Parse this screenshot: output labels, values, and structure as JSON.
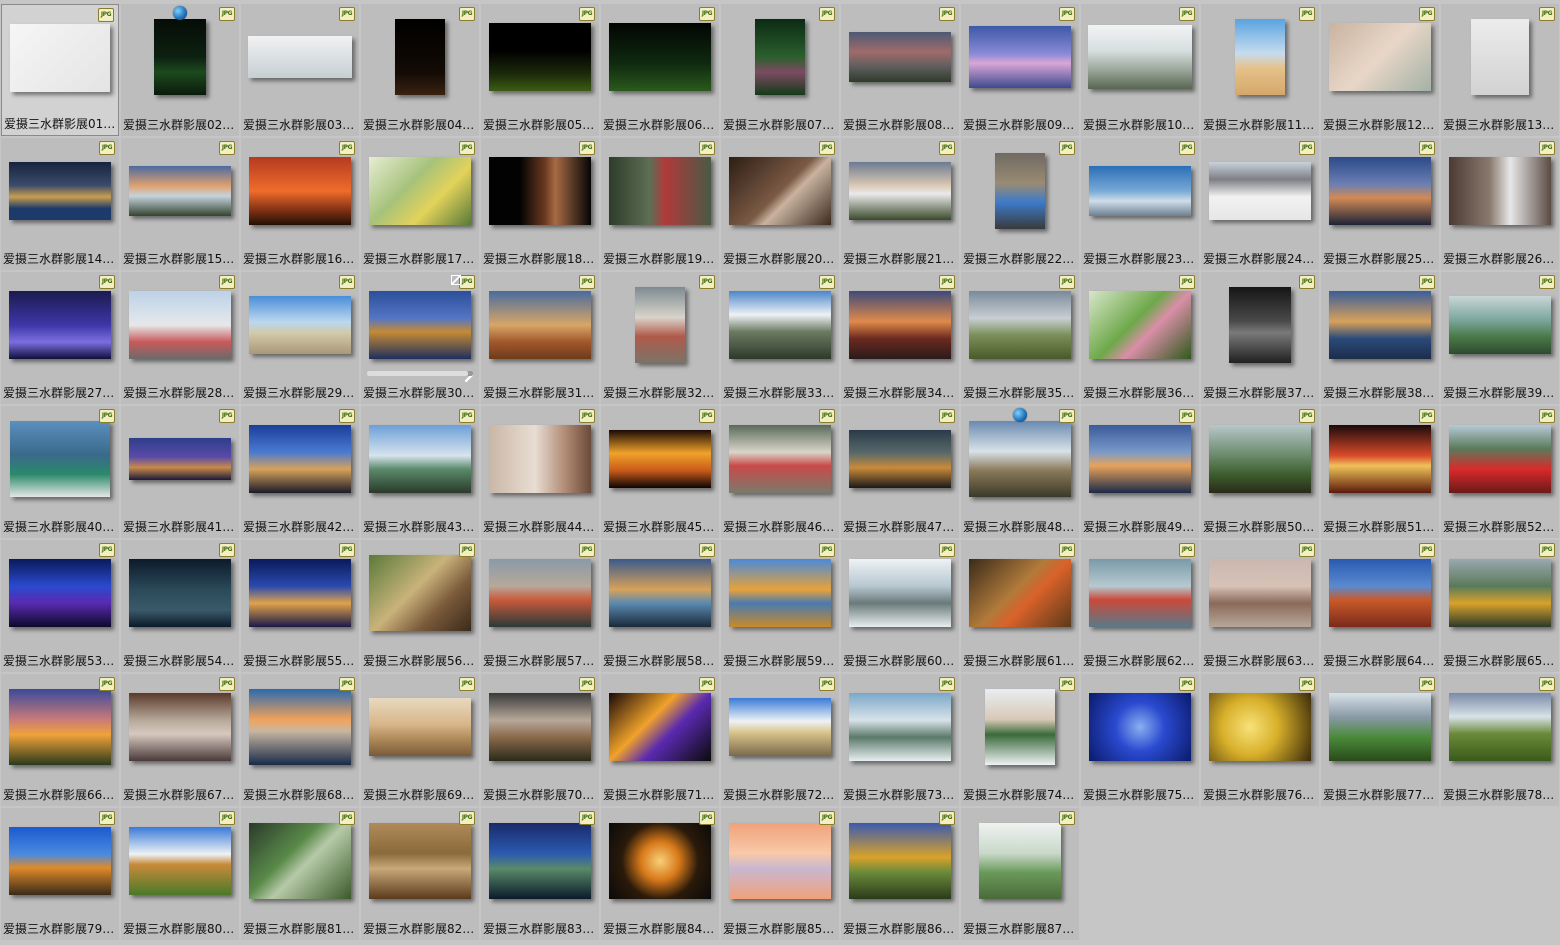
{
  "file_type_badge": "JPG",
  "files": [
    {
      "name": "爱摄三水群影展01.j...",
      "thumb": {
        "w": 100,
        "h": 68,
        "bg": "linear-gradient(135deg,#f6f6f6,#e4e4e4)"
      }
    },
    {
      "name": "爱摄三水群影展02.j...",
      "thumb": {
        "w": 52,
        "h": 76,
        "bg": "linear-gradient(180deg,#050c07 0%,#0d2010 50%,#1d4a1e 70%,#0a1a0c 100%)"
      }
    },
    {
      "name": "爱摄三水群影展03.j...",
      "thumb": {
        "w": 104,
        "h": 42,
        "bg": "linear-gradient(180deg,#f2f2f2,#d7dde0 60%,#c8cfd3)"
      }
    },
    {
      "name": "爱摄三水群影展04.J...",
      "thumb": {
        "w": 50,
        "h": 76,
        "bg": "linear-gradient(180deg,#000,#120a05 70%,#3a2210)"
      }
    },
    {
      "name": "爱摄三水群影展05.J...",
      "thumb": {
        "w": 102,
        "h": 68,
        "bg": "linear-gradient(180deg,#000 40%,#1c2a0a 75%,#3c5d12)"
      }
    },
    {
      "name": "爱摄三水群影展06.J...",
      "thumb": {
        "w": 102,
        "h": 68,
        "bg": "linear-gradient(180deg,#020502,#0f2a10 60%,#2b5a1c)"
      }
    },
    {
      "name": "爱摄三水群影展07.j...",
      "thumb": {
        "w": 50,
        "h": 76,
        "bg": "linear-gradient(180deg,#0c2a14,#2b5f2d 50%,#7c4b62 70%,#153a19)"
      }
    },
    {
      "name": "爱摄三水群影展08.j...",
      "thumb": {
        "w": 102,
        "h": 50,
        "bg": "linear-gradient(180deg,#4d5a73,#a06b6b 40%,#5d5d5d 70%,#2f3b2a)"
      }
    },
    {
      "name": "爱摄三水群影展09.j...",
      "thumb": {
        "w": 102,
        "h": 62,
        "bg": "linear-gradient(180deg,#3d59a7,#8a8ad6 45%,#d9a6d6 60%,#3d4a8f)"
      }
    },
    {
      "name": "爱摄三水群影展10.j...",
      "thumb": {
        "w": 104,
        "h": 64,
        "bg": "linear-gradient(180deg,#f2f4f4,#d7dfe0 40%,#9aa79a 70%,#586652)"
      }
    },
    {
      "name": "爱摄三水群影展11.j...",
      "thumb": {
        "w": 50,
        "h": 76,
        "bg": "linear-gradient(180deg,#5aa3e0,#c6dcef 45%,#e6c189 65%,#d4a86b)"
      }
    },
    {
      "name": "爱摄三水群影展12.j...",
      "thumb": {
        "w": 102,
        "h": 68,
        "bg": "linear-gradient(135deg,#c9b3a0,#e8d7c8 50%,#a4b1a6)"
      }
    },
    {
      "name": "爱摄三水群影展13.J...",
      "thumb": {
        "w": 58,
        "h": 76,
        "bg": "linear-gradient(180deg,#ececec,#d2d2d2)"
      }
    },
    {
      "name": "爱摄三水群影展14.j...",
      "thumb": {
        "w": 102,
        "h": 58,
        "bg": "linear-gradient(180deg,#17243d,#3a4a6b 40%,#c89e4f 60%,#1c3b6b 80%)"
      }
    },
    {
      "name": "爱摄三水群影展15.j...",
      "thumb": {
        "w": 102,
        "h": 50,
        "bg": "linear-gradient(180deg,#4d6a9f,#e0a26f 40%,#c5d3dc 60%,#33432f)"
      }
    },
    {
      "name": "爱摄三水群影展16.j...",
      "thumb": {
        "w": 102,
        "h": 68,
        "bg": "linear-gradient(180deg,#b53a1f,#f06c2b 50%,#7a2d14 80%,#221005)"
      }
    },
    {
      "name": "爱摄三水群影展17.j...",
      "thumb": {
        "w": 102,
        "h": 68,
        "bg": "linear-gradient(135deg,#e6edd4,#a6c27a 40%,#e3d35a 65%,#587a38)"
      }
    },
    {
      "name": "爱摄三水群影展18.j...",
      "thumb": {
        "w": 102,
        "h": 68,
        "bg": "linear-gradient(90deg,#020202 30%,#6b3a22 55%,#a76a44 65%,#050505)"
      }
    },
    {
      "name": "爱摄三水群影展19.j...",
      "thumb": {
        "w": 102,
        "h": 68,
        "bg": "linear-gradient(90deg,#2e3c2a,#5d6f55 40%,#b03a3a 55%,#4a5a45)"
      }
    },
    {
      "name": "爱摄三水群影展20.J...",
      "thumb": {
        "w": 102,
        "h": 68,
        "bg": "linear-gradient(135deg,#2d1d14,#7a5a44 50%,#c9b3a0 60%,#3b2a1f)"
      }
    },
    {
      "name": "爱摄三水群影展21.j...",
      "thumb": {
        "w": 102,
        "h": 58,
        "bg": "linear-gradient(180deg,#6c7b92,#d9c8b3 40%,#eaeaea 55%,#3a4a2a)"
      }
    },
    {
      "name": "爱摄三水群影展22.j...",
      "thumb": {
        "w": 50,
        "h": 76,
        "bg": "linear-gradient(180deg,#6f6a62,#9a8b74 40%,#3d7ac9 65%,#3a3a3a)"
      }
    },
    {
      "name": "爱摄三水群影展23.j...",
      "thumb": {
        "w": 102,
        "h": 50,
        "bg": "linear-gradient(180deg,#2a6fb6,#79a9d6 50%,#cfdde8 70%,#6d7f92)"
      }
    },
    {
      "name": "爱摄三水群影展24.j...",
      "thumb": {
        "w": 102,
        "h": 58,
        "bg": "linear-gradient(180deg,#c9d2da,#7e7f86 30%,#f2f2f2 60%,#e6e6e6)"
      }
    },
    {
      "name": "爱摄三水群影展25.j...",
      "thumb": {
        "w": 102,
        "h": 68,
        "bg": "linear-gradient(180deg,#2c4a8a,#6b7fb2 40%,#d28a55 60%,#1d2338)"
      }
    },
    {
      "name": "爱摄三水群影展26.j...",
      "thumb": {
        "w": 102,
        "h": 68,
        "bg": "linear-gradient(90deg,#4a3b34,#8a7a6e 40%,#e7e7e7 60%,#5b4b44)"
      }
    },
    {
      "name": "爱摄三水群影展27.J...",
      "thumb": {
        "w": 102,
        "h": 68,
        "bg": "linear-gradient(180deg,#1b1b4e,#3d36a8 50%,#7c6ee0 75%,#10103a)"
      }
    },
    {
      "name": "爱摄三水群影展28.j...",
      "thumb": {
        "w": 102,
        "h": 68,
        "bg": "linear-gradient(180deg,#bcd2e8,#e6e8ea 50%,#c95a5a 75%,#6a6a6a)"
      }
    },
    {
      "name": "爱摄三水群影展29.j...",
      "thumb": {
        "w": 102,
        "h": 58,
        "bg": "linear-gradient(180deg,#4a8ed8,#bcd8ef 45%,#d2c8a8 65%,#a89876)"
      }
    },
    {
      "name": "爱摄三水群影展30.j...",
      "thumb": {
        "w": 102,
        "h": 68,
        "bg": "linear-gradient(180deg,#2c4f9a,#5375c4 40%,#c58a34 60%,#1f2f5d)"
      },
      "hover": true
    },
    {
      "name": "爱摄三水群影展31.j...",
      "thumb": {
        "w": 102,
        "h": 68,
        "bg": "linear-gradient(180deg,#496b9e,#d8a667 50%,#a0582c 75%,#6d3b1b)"
      }
    },
    {
      "name": "爱摄三水群影展32.j...",
      "thumb": {
        "w": 50,
        "h": 76,
        "bg": "linear-gradient(180deg,#7e8a91,#d9d4cb 40%,#b05a4a 65%,#7b7368)"
      }
    },
    {
      "name": "爱摄三水群影展33.j...",
      "thumb": {
        "w": 102,
        "h": 68,
        "bg": "linear-gradient(180deg,#4c86c9,#eef2f5 35%,#6b7a62 60%,#2d3a2a)"
      }
    },
    {
      "name": "爱摄三水群影展34.j...",
      "thumb": {
        "w": 102,
        "h": 68,
        "bg": "linear-gradient(180deg,#3d4a7a,#e08a4a 45%,#6b2a1f 70%,#2a1a1a)"
      }
    },
    {
      "name": "爱摄三水群影展35.j...",
      "thumb": {
        "w": 102,
        "h": 68,
        "bg": "linear-gradient(180deg,#7a8a9a,#c9cfd3 40%,#7a8f5a 65%,#4a5a2a)"
      }
    },
    {
      "name": "爱摄三水群影展36.j...",
      "thumb": {
        "w": 102,
        "h": 68,
        "bg": "linear-gradient(135deg,#d7e6c9,#6ea84a 45%,#d98fa7 60%,#2f5a1e)"
      }
    },
    {
      "name": "爱摄三水群影展37.j...",
      "thumb": {
        "w": 62,
        "h": 76,
        "bg": "linear-gradient(180deg,#151515,#4a4a4a 45%,#7a7a7a 60%,#202020)"
      }
    },
    {
      "name": "爱摄三水群影展38.j...",
      "thumb": {
        "w": 102,
        "h": 68,
        "bg": "linear-gradient(180deg,#3a5e9a,#d8a15a 45%,#2a4a7a 70%,#1d2d4a)"
      }
    },
    {
      "name": "爱摄三水群影展39.j...",
      "thumb": {
        "w": 102,
        "h": 58,
        "bg": "linear-gradient(180deg,#c9d6d6,#7ea8a0 40%,#4a7a4a 70%,#2f4a2f)"
      }
    },
    {
      "name": "爱摄三水群影展40.j...",
      "thumb": {
        "w": 100,
        "h": 76,
        "bg": "linear-gradient(180deg,#5a8fbf,#3a6a8a 45%,#2a8a6a 70%,#e6e6e6)"
      }
    },
    {
      "name": "爱摄三水群影展41.j...",
      "thumb": {
        "w": 102,
        "h": 42,
        "bg": "linear-gradient(180deg,#2d3f8a,#5a4aa8 45%,#c98a4a 70%,#1a1a3a)"
      }
    },
    {
      "name": "爱摄三水群影展42.j...",
      "thumb": {
        "w": 102,
        "h": 68,
        "bg": "linear-gradient(180deg,#1a3e9a,#4a7ad0 40%,#d7a25a 65%,#1a1a2a)"
      }
    },
    {
      "name": "爱摄三水群影展43.j...",
      "thumb": {
        "w": 102,
        "h": 68,
        "bg": "linear-gradient(180deg,#6ca0d8,#d7e3ee 45%,#5a8a6a 65%,#2a3a2a)"
      }
    },
    {
      "name": "爱摄三水群影展44.j...",
      "thumb": {
        "w": 102,
        "h": 68,
        "bg": "linear-gradient(90deg,#c9b7a6,#e8ddd3 45%,#b08a74 75%,#6a4a3a)"
      }
    },
    {
      "name": "爱摄三水群影展45.j...",
      "thumb": {
        "w": 102,
        "h": 58,
        "bg": "linear-gradient(180deg,#1a0a05,#f0a22a 40%,#c95a1a 70%,#0a0505)"
      }
    },
    {
      "name": "爱摄三水群影展46.j...",
      "thumb": {
        "w": 102,
        "h": 68,
        "bg": "linear-gradient(180deg,#5a6a5a,#d9d5c9 40%,#c94a4a 60%,#7a7a6a)"
      }
    },
    {
      "name": "爱摄三水群影展47.j...",
      "thumb": {
        "w": 102,
        "h": 58,
        "bg": "linear-gradient(180deg,#2a3a4a,#5a6a6a 40%,#c98a3a 65%,#1a1a1a)"
      }
    },
    {
      "name": "爱摄三水群影展48.j...",
      "thumb": {
        "w": 102,
        "h": 76,
        "bg": "linear-gradient(180deg,#6a8ab0,#d8e2e8 40%,#8a7a5a 65%,#3a3a2a)"
      }
    },
    {
      "name": "爱摄三水群影展49.j...",
      "thumb": {
        "w": 102,
        "h": 68,
        "bg": "linear-gradient(180deg,#3a5a9a,#7a9ac9 40%,#e8a25a 60%,#1a2a4a)"
      }
    },
    {
      "name": "爱摄三水群影展50.j...",
      "thumb": {
        "w": 102,
        "h": 68,
        "bg": "linear-gradient(180deg,#b7c7c9,#6a8a6a 45%,#3a5a2a 75%,#2a2a1a)"
      }
    },
    {
      "name": "爱摄三水群影展51.j...",
      "thumb": {
        "w": 102,
        "h": 68,
        "bg": "linear-gradient(180deg,#1a0a0a,#d94a2a 45%,#f0c25a 60%,#5a1a0a)"
      }
    },
    {
      "name": "爱摄三水群影展52.j...",
      "thumb": {
        "w": 102,
        "h": 68,
        "bg": "linear-gradient(180deg,#b7c9d8,#5a7a5a 35%,#d92a2a 65%,#6a1a1a)"
      }
    },
    {
      "name": "爱摄三水群影展53.j...",
      "thumb": {
        "w": 102,
        "h": 68,
        "bg": "linear-gradient(180deg,#0a1a5a,#2a4ad0 40%,#5a2ab0 65%,#0a0a2a)"
      }
    },
    {
      "name": "爱摄三水群影展54.J...",
      "thumb": {
        "w": 102,
        "h": 68,
        "bg": "linear-gradient(180deg,#0d1a2a,#2a4a5a 45%,#3a5a6a 75%,#0a1a2a)"
      }
    },
    {
      "name": "爱摄三水群影展55.j...",
      "thumb": {
        "w": 102,
        "h": 68,
        "bg": "linear-gradient(180deg,#0a1a5a,#2a4ab0 40%,#e0a24a 65%,#1a1a4a)"
      }
    },
    {
      "name": "爱摄三水群影展56.j...",
      "thumb": {
        "w": 102,
        "h": 76,
        "bg": "linear-gradient(135deg,#5a7a3a,#c9b37a 45%,#7a5a3a 70%,#3a2a1a)"
      }
    },
    {
      "name": "爱摄三水群影展57.j...",
      "thumb": {
        "w": 102,
        "h": 68,
        "bg": "linear-gradient(180deg,#8a9aa8,#b7a89a 40%,#c95a3a 60%,#2a3a3a)"
      }
    },
    {
      "name": "爱摄三水群影展58.j...",
      "thumb": {
        "w": 102,
        "h": 68,
        "bg": "linear-gradient(180deg,#3a5a8a,#d8a25a 45%,#5a8ab0 65%,#1a2a3a)"
      }
    },
    {
      "name": "爱摄三水群影展59.j...",
      "thumb": {
        "w": 102,
        "h": 68,
        "bg": "linear-gradient(180deg,#4a8ad8,#e8a23a 45%,#4a7ab0 65%,#c98a2a)"
      }
    },
    {
      "name": "爱摄三水群影展60.j...",
      "thumb": {
        "w": 102,
        "h": 68,
        "bg": "linear-gradient(180deg,#eef2f5,#b7c7d0 40%,#6a7a7a 65%,#e8eef0)"
      }
    },
    {
      "name": "爱摄三水群影展61.j...",
      "thumb": {
        "w": 102,
        "h": 68,
        "bg": "linear-gradient(135deg,#3a2a1a,#b07a3a 45%,#d9622a 60%,#5a3a1a)"
      }
    },
    {
      "name": "爱摄三水群影展62.j...",
      "thumb": {
        "w": 102,
        "h": 68,
        "bg": "linear-gradient(180deg,#7a9aa8,#b7c9d0 40%,#c94a3a 60%,#5a7a8a)"
      }
    },
    {
      "name": "爱摄三水群影展63.j...",
      "thumb": {
        "w": 102,
        "h": 68,
        "bg": "linear-gradient(180deg,#c9b7b0,#d8c2b7 40%,#8a6a5a 65%,#b7a89a)"
      }
    },
    {
      "name": "爱摄三水群影展64.J...",
      "thumb": {
        "w": 102,
        "h": 68,
        "bg": "linear-gradient(180deg,#2a5ab0,#5a8ad0 40%,#c95a2a 60%,#7a2a1a)"
      }
    },
    {
      "name": "爱摄三水群影展65.j...",
      "thumb": {
        "w": 102,
        "h": 68,
        "bg": "linear-gradient(180deg,#9aa8b0,#5a7a5a 40%,#d8a22a 65%,#2a3a2a)"
      }
    },
    {
      "name": "爱摄三水群影展66.j...",
      "thumb": {
        "w": 102,
        "h": 76,
        "bg": "linear-gradient(180deg,#3a4a9a,#c97a7a 40%,#f0a23a 60%,#2a3a1a)"
      }
    },
    {
      "name": "爱摄三水群影展67.j...",
      "thumb": {
        "w": 102,
        "h": 68,
        "bg": "linear-gradient(180deg,#5a3a2a,#b7a89a 40%,#d8c9c0 60%,#4a3a3a)"
      }
    },
    {
      "name": "爱摄三水群影展68.j...",
      "thumb": {
        "w": 102,
        "h": 76,
        "bg": "linear-gradient(180deg,#2a6ab0,#f0a25a 40%,#c9b7a0 55%,#1a2a4a)"
      }
    },
    {
      "name": "爱摄三水群影展69.j...",
      "thumb": {
        "w": 102,
        "h": 58,
        "bg": "linear-gradient(180deg,#e8d9c0,#d8b78a 45%,#b08a5a 70%,#7a5a3a)"
      }
    },
    {
      "name": "爱摄三水群影展70.j...",
      "thumb": {
        "w": 102,
        "h": 68,
        "bg": "linear-gradient(180deg,#3a3a3a,#b7a89a 40%,#8a6a4a 65%,#2a2a1a)"
      }
    },
    {
      "name": "爱摄三水群影展71.j...",
      "thumb": {
        "w": 102,
        "h": 68,
        "bg": "linear-gradient(135deg,#1a0a0a,#f0a22a 40%,#5a2ab0 60%,#0a0a0a)"
      }
    },
    {
      "name": "爱摄三水群影展72.j...",
      "thumb": {
        "w": 102,
        "h": 58,
        "bg": "linear-gradient(180deg,#3a7ad8,#eef2f5 40%,#d8c28a 60%,#7a6a4a)"
      }
    },
    {
      "name": "爱摄三水群影展73.j...",
      "thumb": {
        "w": 102,
        "h": 68,
        "bg": "linear-gradient(180deg,#7aa8c9,#d8e2e8 40%,#5a7a6a 65%,#e8eef0)"
      }
    },
    {
      "name": "爱摄三水群影展74.j...",
      "thumb": {
        "w": 70,
        "h": 76,
        "bg": "linear-gradient(180deg,#e8eef0,#d8c9b7 40%,#3a6a3a 60%,#eef2f5)"
      }
    },
    {
      "name": "爱摄三水群影展75.j...",
      "thumb": {
        "w": 102,
        "h": 68,
        "bg": "radial-gradient(circle at 50% 50%,#8ab0f0,#2a4ad0 40%,#0a1a6a)"
      }
    },
    {
      "name": "爱摄三水群影展76.j...",
      "thumb": {
        "w": 102,
        "h": 68,
        "bg": "radial-gradient(circle at 40% 50%,#f8e27a,#d8b02a 40%,#3a2a0a)"
      }
    },
    {
      "name": "爱摄三水群影展77.j...",
      "thumb": {
        "w": 102,
        "h": 68,
        "bg": "linear-gradient(180deg,#d8e2e8,#8a9aa8 35%,#4a8a3a 65%,#2a4a1a)"
      }
    },
    {
      "name": "爱摄三水群影展78.j...",
      "thumb": {
        "w": 102,
        "h": 68,
        "bg": "linear-gradient(180deg,#7a8aa8,#d8e2e8 35%,#6a8a3a 60%,#3a5a1a)"
      }
    },
    {
      "name": "爱摄三水群影展79.j...",
      "thumb": {
        "w": 102,
        "h": 68,
        "bg": "linear-gradient(180deg,#1a5ad0,#4a8ae0 40%,#e08a2a 60%,#3a2a1a)"
      }
    },
    {
      "name": "爱摄三水群影展80.j...",
      "thumb": {
        "w": 102,
        "h": 68,
        "bg": "linear-gradient(180deg,#3a7ad8,#eef2f5 40%,#c98a3a 55%,#4a7a2a)"
      }
    },
    {
      "name": "爱摄三水群影展81.j...",
      "thumb": {
        "w": 102,
        "h": 76,
        "bg": "linear-gradient(135deg,#2a3a2a,#5a8a4a 40%,#b7c9a8 55%,#3a5a2a)"
      }
    },
    {
      "name": "爱摄三水群影展82.j...",
      "thumb": {
        "w": 102,
        "h": 76,
        "bg": "linear-gradient(180deg,#b08a5a,#8a6a3a 40%,#c9a87a 60%,#5a3a1a)"
      }
    },
    {
      "name": "爱摄三水群影展83.j...",
      "thumb": {
        "w": 102,
        "h": 76,
        "bg": "linear-gradient(180deg,#1a2a6a,#2a5ab0 40%,#5a8a6a 60%,#0a1a2a)"
      }
    },
    {
      "name": "爱摄三水群影展84.j...",
      "thumb": {
        "w": 102,
        "h": 76,
        "bg": "radial-gradient(circle at 50% 50%,#f8d07a,#d87a1a 30%,#2a1a0a 60%,#0a0a0a)"
      }
    },
    {
      "name": "爱摄三水群影展85.j...",
      "thumb": {
        "w": 102,
        "h": 76,
        "bg": "linear-gradient(180deg,#f0a27a,#f8c9a8 40%,#c9b7d0 60%,#f0a27a)"
      }
    },
    {
      "name": "爱摄三水群影展86.j...",
      "thumb": {
        "w": 102,
        "h": 76,
        "bg": "linear-gradient(180deg,#3a5ab0,#d8a22a 45%,#6a8a3a 65%,#2a3a1a)"
      }
    },
    {
      "name": "爱摄三水群影展87.j...",
      "thumb": {
        "w": 82,
        "h": 76,
        "bg": "linear-gradient(180deg,#eef2f0,#c9d8c9 40%,#6a9a5a 65%,#4a6a3a)"
      }
    }
  ]
}
